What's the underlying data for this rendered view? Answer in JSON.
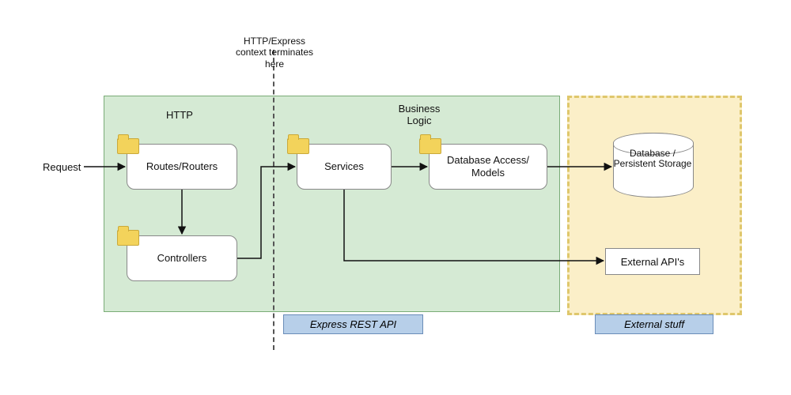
{
  "annotation": "HTTP/Express context terminates here",
  "request_label": "Request",
  "sections": {
    "http": "HTTP",
    "business": "Business Logic"
  },
  "nodes": {
    "routes": "Routes/Routers",
    "controllers": "Controllers",
    "services": "Services",
    "dam": "Database Access/ Models",
    "external_apis": "External API's"
  },
  "db_label": "Database / Persistent Storage",
  "captions": {
    "express": "Express REST API",
    "external": "External stuff"
  }
}
